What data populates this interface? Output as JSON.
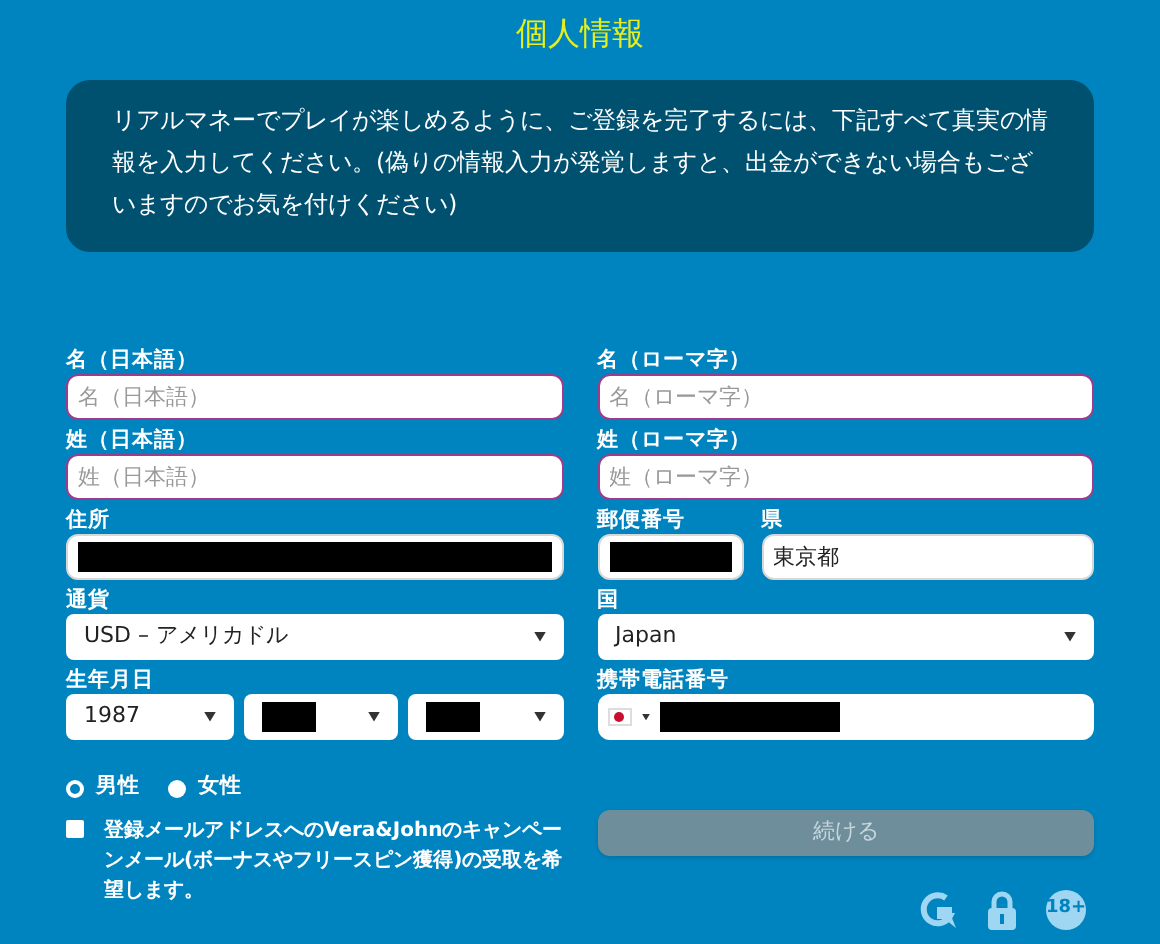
{
  "title": "個人情報",
  "notice": "リアルマネーでプレイが楽しめるように、ご登録を完了するには、下記すべて真実の情報を入力してください。(偽りの情報入力が発覚しますと、出金ができない場合もございますのでお気を付けください)",
  "left_column": [
    {
      "kind": "text",
      "label": "名（日本語）",
      "placeholder": "名（日本語）",
      "invalid": true
    },
    {
      "kind": "text",
      "label": "姓（日本語）",
      "placeholder": "姓（日本語）",
      "invalid": true
    },
    {
      "kind": "text",
      "label": "住所",
      "redacted": true,
      "invalid": false
    },
    {
      "kind": "select",
      "label": "通貨",
      "value": "USD – アメリカドル"
    },
    {
      "kind": "date",
      "label": "生年月日",
      "parts": [
        {
          "value": "1987",
          "redacted": false
        },
        {
          "redacted": true
        },
        {
          "redacted": true
        }
      ]
    }
  ],
  "right_column": [
    {
      "kind": "text",
      "label": "名（ローマ字）",
      "placeholder": "名（ローマ字）",
      "invalid": true
    },
    {
      "kind": "text",
      "label": "姓（ローマ字）",
      "placeholder": "姓（ローマ字）",
      "invalid": true
    },
    {
      "kind": "pair",
      "items": [
        {
          "label": "郵便番号",
          "redacted": true
        },
        {
          "label": "県",
          "value": "東京都",
          "redacted": false
        }
      ]
    },
    {
      "kind": "select",
      "label": "国",
      "value": "Japan"
    },
    {
      "kind": "phone",
      "label": "携帯電話番号",
      "redacted": true
    }
  ],
  "gender": [
    {
      "label": "男性",
      "selected": true
    },
    {
      "label": "女性",
      "selected": false
    }
  ],
  "newsletter": {
    "label": "登録メールアドレスへのVera&Johnのキャンペーンメール(ボーナスやフリースピン獲得)の受取を希望します。",
    "checked": false
  },
  "continue_button": {
    "label": "続ける",
    "disabled": true
  },
  "age_badge": "18+"
}
